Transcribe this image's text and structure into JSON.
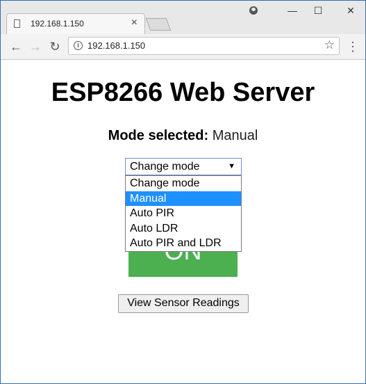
{
  "browser": {
    "tab_title": "192.168.1.150",
    "url": "192.168.1.150",
    "tab_close_glyph": "×",
    "minimize_glyph": "—",
    "maximize_glyph": "☐",
    "close_glyph": "✕",
    "back_glyph": "←",
    "forward_glyph": "→",
    "reload_glyph": "↻",
    "star_glyph": "☆",
    "menu_glyph": "⋮",
    "info_glyph": "i"
  },
  "page": {
    "heading": "ESP8266 Web Server",
    "mode_label": "Mode selected:",
    "mode_value": "Manual",
    "select": {
      "current": "Change mode",
      "arrow": "▼",
      "options": [
        "Change mode",
        "Manual",
        "Auto PIR",
        "Auto LDR",
        "Auto PIR and LDR"
      ],
      "highlighted_index": 1
    },
    "on_button_label": "ON",
    "sensor_button_label": "View Sensor Readings"
  },
  "colors": {
    "on_button": "#4caf50",
    "option_highlight": "#1e90ff",
    "window_border": "#2b6fb5"
  }
}
